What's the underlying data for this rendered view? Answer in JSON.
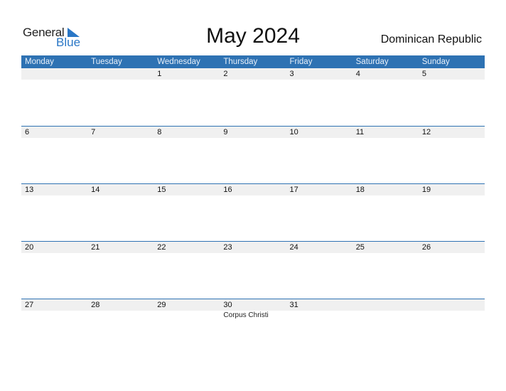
{
  "logo": {
    "general": "General",
    "blue": "Blue"
  },
  "title": "May 2024",
  "country": "Dominican Republic",
  "colors": {
    "accent": "#2e72b3",
    "strip": "#f0f0f0",
    "logo_blue": "#2a77c6"
  },
  "weekdays": [
    "Monday",
    "Tuesday",
    "Wednesday",
    "Thursday",
    "Friday",
    "Saturday",
    "Sunday"
  ],
  "weeks": [
    [
      {
        "day": ""
      },
      {
        "day": ""
      },
      {
        "day": "1"
      },
      {
        "day": "2"
      },
      {
        "day": "3"
      },
      {
        "day": "4"
      },
      {
        "day": "5"
      }
    ],
    [
      {
        "day": "6"
      },
      {
        "day": "7"
      },
      {
        "day": "8"
      },
      {
        "day": "9"
      },
      {
        "day": "10"
      },
      {
        "day": "11"
      },
      {
        "day": "12"
      }
    ],
    [
      {
        "day": "13"
      },
      {
        "day": "14"
      },
      {
        "day": "15"
      },
      {
        "day": "16"
      },
      {
        "day": "17"
      },
      {
        "day": "18"
      },
      {
        "day": "19"
      }
    ],
    [
      {
        "day": "20"
      },
      {
        "day": "21"
      },
      {
        "day": "22"
      },
      {
        "day": "23"
      },
      {
        "day": "24"
      },
      {
        "day": "25"
      },
      {
        "day": "26"
      }
    ],
    [
      {
        "day": "27"
      },
      {
        "day": "28"
      },
      {
        "day": "29"
      },
      {
        "day": "30",
        "event": "Corpus Christi"
      },
      {
        "day": "31"
      },
      {
        "day": ""
      },
      {
        "day": ""
      }
    ]
  ]
}
